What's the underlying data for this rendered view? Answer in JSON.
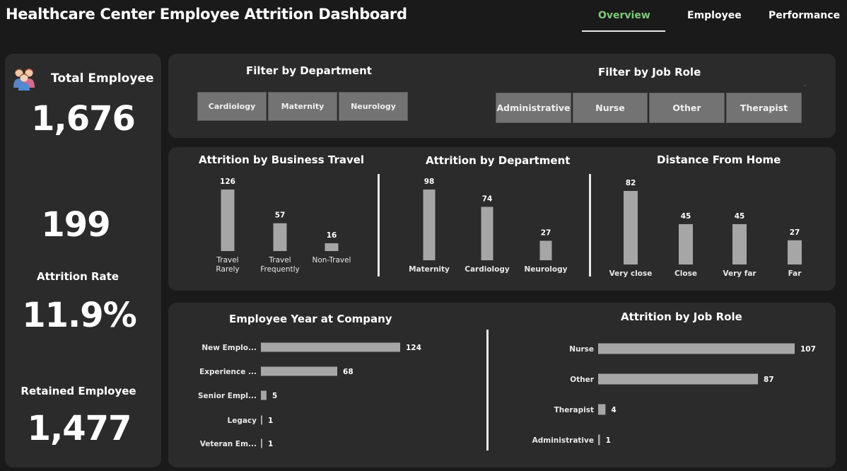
{
  "header": {
    "title": "Healthcare Center Employee Attrition Dashboard",
    "tabs": [
      {
        "label": "Overview",
        "active": true
      },
      {
        "label": "Employee",
        "active": false
      },
      {
        "label": "Performance",
        "active": false
      }
    ]
  },
  "kpis": {
    "total_employee_label": "Total Employee",
    "total_employee_value": "1,676",
    "attrition_count_value": "199",
    "attrition_rate_label": "Attrition Rate",
    "attrition_rate_value": "11.9%",
    "retained_label": "Retained Employee",
    "retained_value": "1,477"
  },
  "filters": {
    "department_title": "Filter by Department",
    "department_options": [
      "Cardiology",
      "Maternity",
      "Neurology"
    ],
    "job_role_title": "Filter by Job Role",
    "job_role_options": [
      "Administrative",
      "Nurse",
      "Other",
      "Therapist"
    ]
  },
  "colors": {
    "background": "#1a1a1a",
    "panel": "#2b2b2b",
    "bar": "#a6a6a6",
    "active_tab": "#7ec87a",
    "slicer": "#737373"
  },
  "chart_data": [
    {
      "type": "bar",
      "title": "Attrition by Business Travel",
      "categories": [
        "Travel Rarely",
        "Travel Frequently",
        "Non-Travel"
      ],
      "category_lines": [
        [
          "Travel",
          "Rarely"
        ],
        [
          "Travel",
          "Frequently"
        ],
        [
          "Non-Travel"
        ]
      ],
      "values": [
        126,
        57,
        16
      ]
    },
    {
      "type": "bar",
      "title": "Attrition by Department",
      "categories": [
        "Maternity",
        "Cardiology",
        "Neurology"
      ],
      "values": [
        98,
        74,
        27
      ]
    },
    {
      "type": "bar",
      "title": "Distance From Home",
      "categories": [
        "Very close",
        "Close",
        "Very far",
        "Far"
      ],
      "values": [
        82,
        45,
        45,
        27
      ]
    },
    {
      "type": "bar",
      "orientation": "horizontal",
      "title": "Employee Year at Company",
      "categories": [
        "New Emplo...",
        "Experience ...",
        "Senior Empl...",
        "Legacy",
        "Veteran Em..."
      ],
      "values": [
        124,
        68,
        5,
        1,
        1
      ]
    },
    {
      "type": "bar",
      "orientation": "horizontal",
      "title": "Attrition by Job Role",
      "categories": [
        "Nurse",
        "Other",
        "Therapist",
        "Administrative"
      ],
      "values": [
        107,
        87,
        4,
        1
      ]
    }
  ]
}
